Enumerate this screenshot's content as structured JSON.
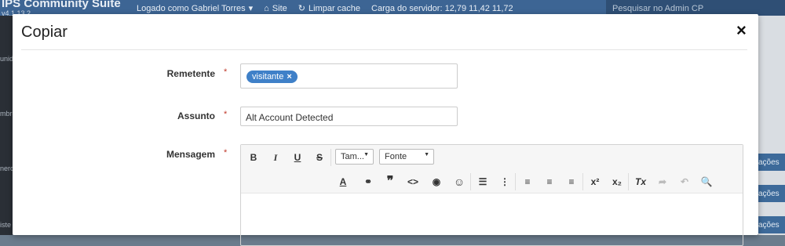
{
  "background": {
    "brand": "IPS Community Suite",
    "version": "v4.1.13.2",
    "logged_as": "Logado como Gabriel Torres",
    "site": "Site",
    "clear_cache": "Limpar cache",
    "server_load": "Carga do servidor: 12,79 11,42 11,72",
    "search_placeholder": "Pesquisar no Admin CP",
    "sidebar_labels": [
      "unid",
      "mbro",
      "nero",
      "iste"
    ],
    "right_buttons": [
      "ações",
      "ações",
      "ações"
    ]
  },
  "modal": {
    "title": "Copiar",
    "close": "×",
    "fields": {
      "remetente": {
        "label": "Remetente",
        "required": "*",
        "tag": "visitante",
        "tag_remove": "×"
      },
      "assunto": {
        "label": "Assunto",
        "required": "*",
        "value": "Alt Account Detected"
      },
      "mensagem": {
        "label": "Mensagem",
        "required": "*"
      }
    },
    "editor": {
      "bold": "B",
      "italic": "I",
      "underline": "U",
      "strike": "S",
      "size_dropdown": "Tam...",
      "font_dropdown": "Fonte"
    }
  },
  "colors": {
    "header": "#3d6594",
    "tag": "#3f80c8",
    "required": "#c0392b"
  }
}
